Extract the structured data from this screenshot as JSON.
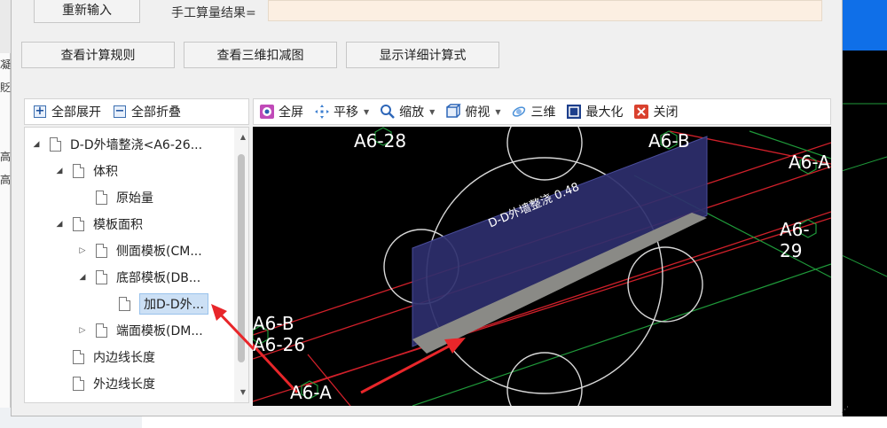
{
  "dialog": {
    "reenter_button": "重新输入",
    "manual_result_label": "手工算量结果=",
    "manual_result_value": "",
    "buttons": {
      "view_rules": "查看计算规则",
      "view_3d_deduction": "查看三维扣减图",
      "show_formula": "显示详细计算式"
    }
  },
  "tree_toolbar": {
    "expand_all": "全部展开",
    "collapse_all": "全部折叠"
  },
  "tree": {
    "items": [
      {
        "label": "D-D外墙整浇<A6-26...",
        "arrow": "expanded"
      },
      {
        "label": "体积",
        "arrow": "expanded"
      },
      {
        "label": "原始量",
        "arrow": "none"
      },
      {
        "label": "模板面积",
        "arrow": "expanded"
      },
      {
        "label": "侧面模板(CM...",
        "arrow": "collapsed"
      },
      {
        "label": "底部模板(DB...",
        "arrow": "expanded"
      },
      {
        "label": "加D-D外...",
        "arrow": "none",
        "selected": true
      },
      {
        "label": "端面模板(DM...",
        "arrow": "collapsed"
      },
      {
        "label": "内边线长度",
        "arrow": "none"
      },
      {
        "label": "外边线长度",
        "arrow": "none"
      }
    ]
  },
  "viewer_toolbar": {
    "fullscreen": "全屏",
    "pan": "平移",
    "zoom": "缩放",
    "top_view": "俯视",
    "three_d": "三维",
    "maximize": "最大化",
    "close": "关闭"
  },
  "viewer": {
    "model_label": "D-D外墙整浇 0.48",
    "axis_labels": {
      "a6_28": "A6-28",
      "a6_b_top": "A6-B",
      "a6_a_right": "A6-A",
      "a6_29": "A6-29",
      "a6_b_left": "A6-B",
      "a6_26": "A6-26",
      "a6_a_bottom": "A6-A"
    }
  },
  "background": {
    "left_fragments": [
      "凝",
      "貶",
      "高",
      "高"
    ]
  },
  "colors": {
    "accent_blue": "#0f6fe8",
    "result_field": "#fcefe2",
    "selection": "#cce0f5",
    "annotation_red": "#e8262a"
  }
}
